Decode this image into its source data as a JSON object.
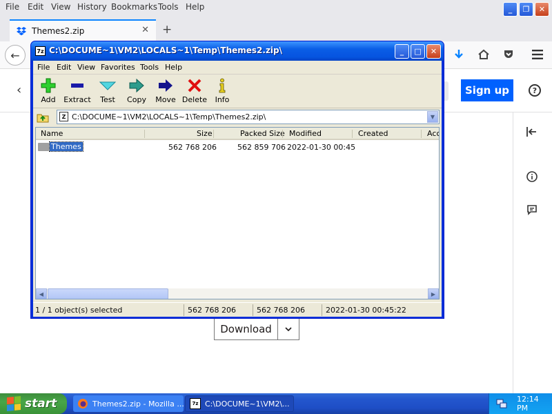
{
  "firefox": {
    "menu": [
      "File",
      "Edit",
      "View",
      "History",
      "Bookmarks",
      "Tools",
      "Help"
    ],
    "tab_title": "Themes2.zip"
  },
  "page": {
    "signup_label": "Sign up",
    "download_label": "Download"
  },
  "sevenzip": {
    "title": "C:\\DOCUME~1\\VM2\\LOCALS~1\\Temp\\Themes2.zip\\",
    "menu": [
      "File",
      "Edit",
      "View",
      "Favorites",
      "Tools",
      "Help"
    ],
    "toolbar": [
      {
        "label": "Add",
        "icon": "plus-icon"
      },
      {
        "label": "Extract",
        "icon": "minus-icon"
      },
      {
        "label": "Test",
        "icon": "check-icon"
      },
      {
        "label": "Copy",
        "icon": "copy-arrow-icon"
      },
      {
        "label": "Move",
        "icon": "move-arrow-icon"
      },
      {
        "label": "Delete",
        "icon": "delete-x-icon"
      },
      {
        "label": "Info",
        "icon": "info-icon"
      }
    ],
    "path": "C:\\DOCUME~1\\VM2\\LOCALS~1\\Temp\\Themes2.zip\\",
    "columns": [
      "Name",
      "Size",
      "Packed Size",
      "Modified",
      "Created",
      "Acce"
    ],
    "rows": [
      {
        "name": "Themes",
        "size": "562 768 206",
        "packed": "562 859 706",
        "modified": "2022-01-30 00:45"
      }
    ],
    "status": {
      "selection": "1 / 1 object(s) selected",
      "size": "562 768 206",
      "packed": "562 768 206",
      "modified": "2022-01-30 00:45:22"
    }
  },
  "taskbar": {
    "start_label": "start",
    "tasks": [
      "Themes2.zip - Mozilla ...",
      "C:\\DOCUME~1\\VM2\\..."
    ],
    "clock": "12:14 PM"
  }
}
